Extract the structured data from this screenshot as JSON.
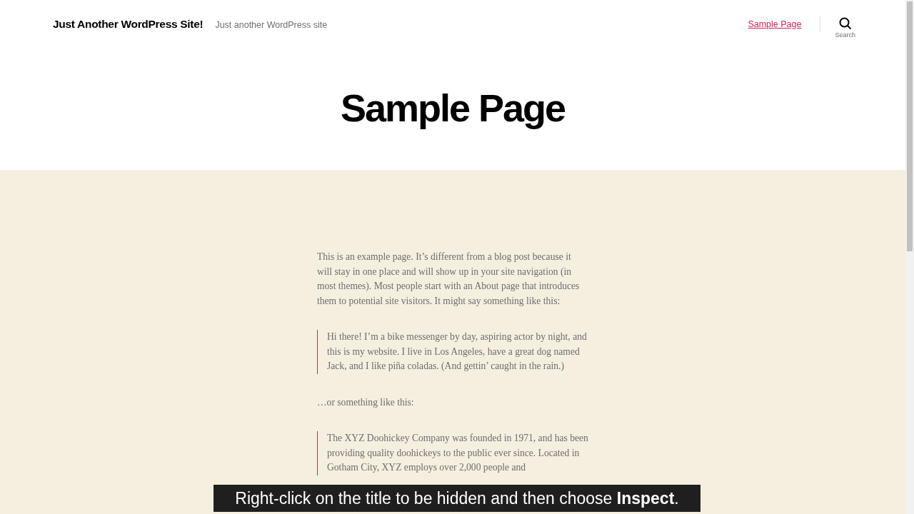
{
  "header": {
    "site_title": "Just Another WordPress Site!",
    "tagline": "Just another WordPress site",
    "nav": [
      {
        "label": "Sample Page",
        "selected": true
      }
    ],
    "search_label": "Search"
  },
  "page_title": "Sample Page",
  "content": [
    {
      "kind": "paragraph",
      "text": "This is an example page. It’s different from a blog post because it will stay in one place and will show up in your site navigation (in most themes). Most people start with an About page that introduces them to potential site visitors. It might say something like this:"
    },
    {
      "kind": "quote",
      "text": "Hi there! I’m a bike messenger by day, aspiring actor by night, and this is my website. I live in Los Angeles, have a great dog named Jack, and I like piña coladas. (And gettin’ caught in the rain.)"
    },
    {
      "kind": "paragraph",
      "text": "…or something like this:"
    },
    {
      "kind": "quote",
      "text": "The XYZ Doohickey Company was founded in 1971, and has been providing quality doohickeys to the public ever since. Located in Gotham City, XYZ employs over 2,000 people and"
    }
  ],
  "caption": "Right-click on the title to be hidden and then choose **Inspect**."
}
